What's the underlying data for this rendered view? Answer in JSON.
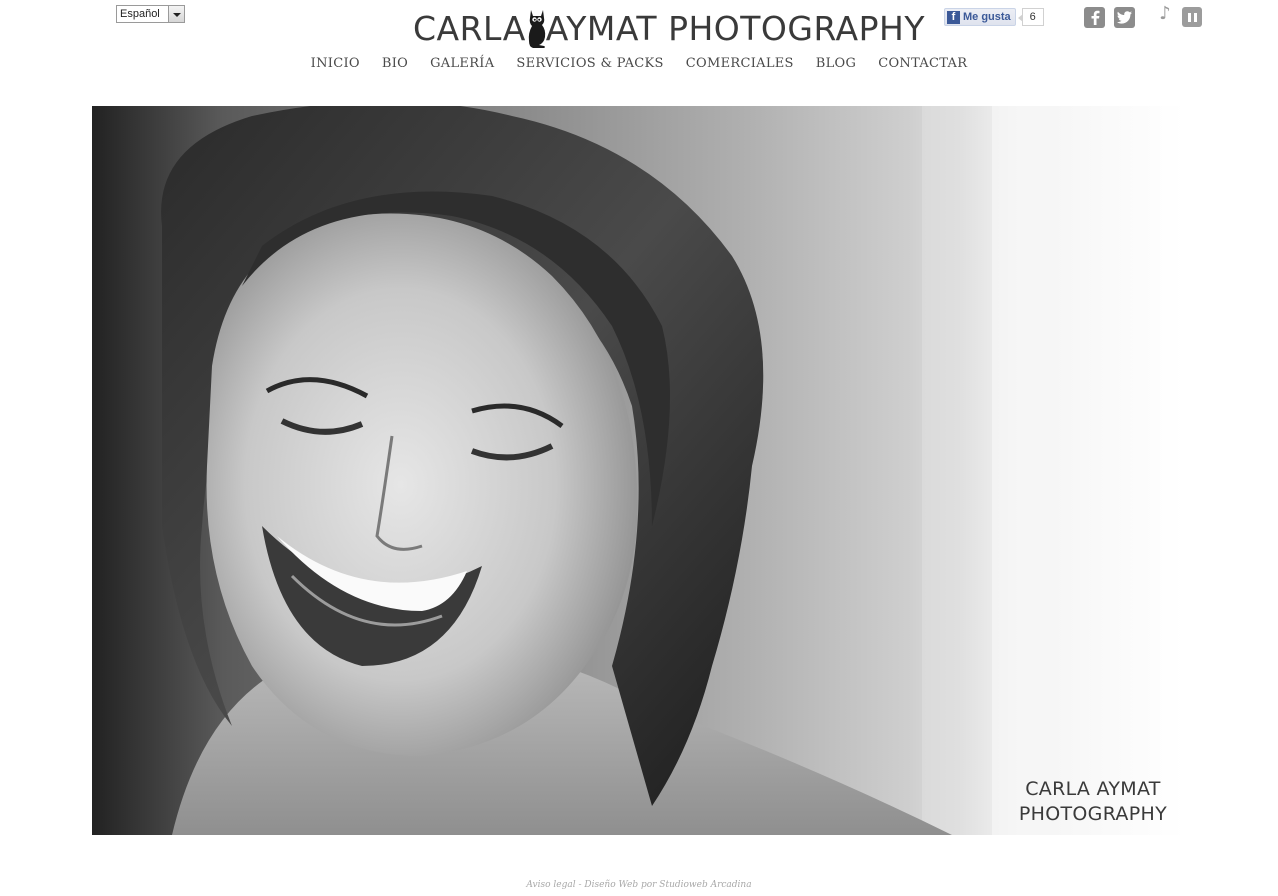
{
  "language_selector": {
    "value": "Español"
  },
  "logo": {
    "text_left": "CARLA",
    "text_right": "AYMAT PHOTOGRAPHY"
  },
  "facebook_like": {
    "label": "Me gusta",
    "count": "6"
  },
  "social": {
    "facebook_icon": "facebook-icon",
    "twitter_icon": "twitter-icon"
  },
  "music": {
    "note_icon": "music-note-icon",
    "pause_icon": "pause-icon"
  },
  "nav": {
    "items": [
      {
        "label": "INICIO"
      },
      {
        "label": "BIO"
      },
      {
        "label": "GALERÍA"
      },
      {
        "label": "SERVICIOS & PACKS"
      },
      {
        "label": "COMERCIALES"
      },
      {
        "label": "BLOG"
      },
      {
        "label": "CONTACTAR"
      }
    ]
  },
  "hero": {
    "watermark_line1": "CARLA AYMAT",
    "watermark_line2": "PHOTOGRAPHY"
  },
  "footer": {
    "text": "Aviso legal - Diseño Web por Studioweb Arcadina"
  }
}
